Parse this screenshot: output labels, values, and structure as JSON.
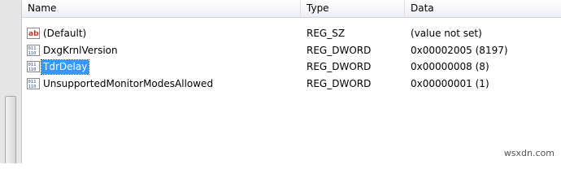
{
  "header": {
    "name": "Name",
    "type": "Type",
    "data": "Data"
  },
  "rows": [
    {
      "icon": "string-value-icon",
      "name": "(Default)",
      "type": "REG_SZ",
      "data": "(value not set)"
    },
    {
      "icon": "binary-value-icon",
      "name": "DxgKrnlVersion",
      "type": "REG_DWORD",
      "data": "0x00002005 (8197)"
    },
    {
      "icon": "binary-value-icon",
      "name": "TdrDelay",
      "type": "REG_DWORD",
      "data": "0x00000008 (8)",
      "selected": true
    },
    {
      "icon": "binary-value-icon",
      "name": "UnsupportedMonitorModesAllowed",
      "type": "REG_DWORD",
      "data": "0x00000001 (1)"
    }
  ],
  "watermark": "wsxdn.com",
  "colors": {
    "selection": "#3399ff",
    "header_bg": "#f1f3f6"
  }
}
